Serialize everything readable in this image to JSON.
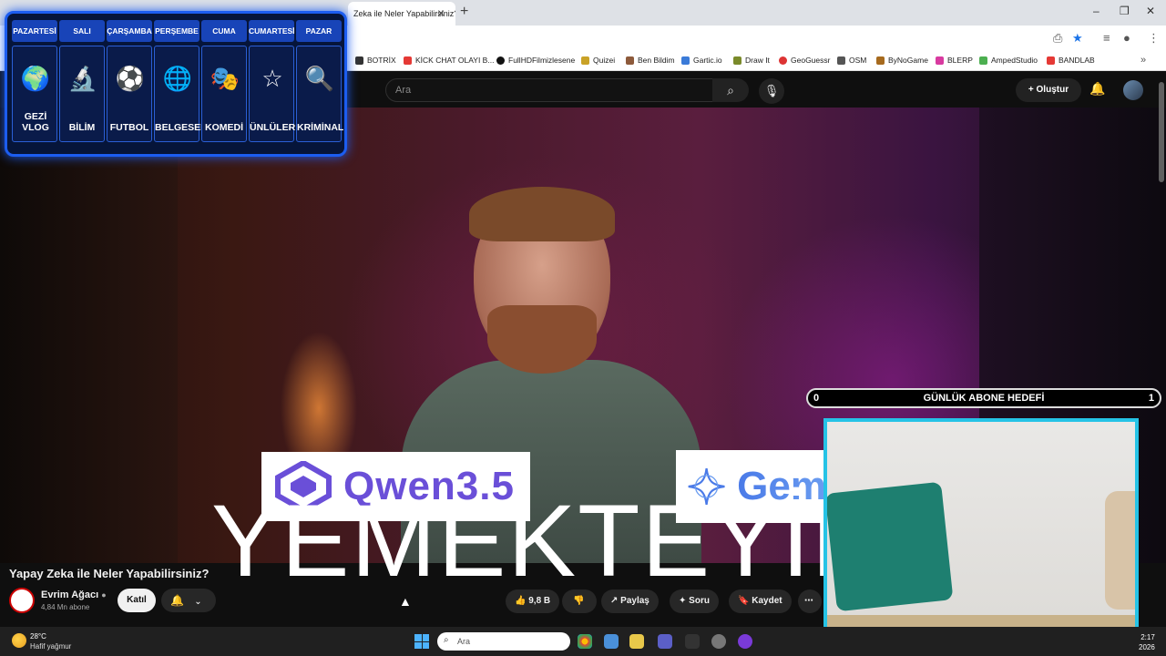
{
  "browser": {
    "tab_title": "Zeka ile Neler Yapabilirsiniz?",
    "bookmarks": [
      "BOTRİX",
      "KİCK CHAT OLAYI B...",
      "FullHDFilmizlesene",
      "Quizei",
      "Ben Bildim",
      "Gartic.io",
      "Draw It",
      "GeoGuessr",
      "OSM",
      "ByNoGame",
      "BLERP",
      "AmpedStudio",
      "BANDLAB"
    ]
  },
  "youtube": {
    "search_placeholder": "Ara",
    "create_label": "Oluştur"
  },
  "schedule": {
    "days": [
      {
        "day": "PAZARTESİ",
        "label": "GEZİ VLOG",
        "icon": "globe-plane-icon"
      },
      {
        "day": "SALI",
        "label": "BİLİM",
        "icon": "microscope-icon"
      },
      {
        "day": "ÇARŞAMBA",
        "label": "FUTBOL",
        "icon": "soccer-ball-icon"
      },
      {
        "day": "PERŞEMBE",
        "label": "BELGESEL",
        "icon": "earth-icon"
      },
      {
        "day": "CUMA",
        "label": "KOMEDİ",
        "icon": "theater-mask-icon"
      },
      {
        "day": "CUMARTESİ",
        "label": "ÜNLÜLER",
        "icon": "star-icon"
      },
      {
        "day": "PAZAR",
        "label": "KRİMİNAL",
        "icon": "fingerprint-icon"
      }
    ]
  },
  "video": {
    "logo_qwen": "Qwen3.5",
    "logo_gem": "Gem",
    "overlay_text": "YEMEKTEYİM",
    "title": "Yapay Zeka ile Neler Yapabilirsiniz?",
    "channel_name": "Evrim Ağacı",
    "subscribers": "4,84 Mn abone",
    "join_label": "Katıl",
    "likes": "9,8 B",
    "share_label": "Paylaş",
    "ask_label": "Soru",
    "save_label": "Kaydet"
  },
  "goal": {
    "start": "0",
    "title": "GÜNLÜK ABONE HEDEFİ",
    "end": "1"
  },
  "taskbar": {
    "temperature": "28°C",
    "weather": "Hafif yağmur",
    "search_placeholder": "Ara",
    "time": "2:17",
    "year": "2026"
  }
}
